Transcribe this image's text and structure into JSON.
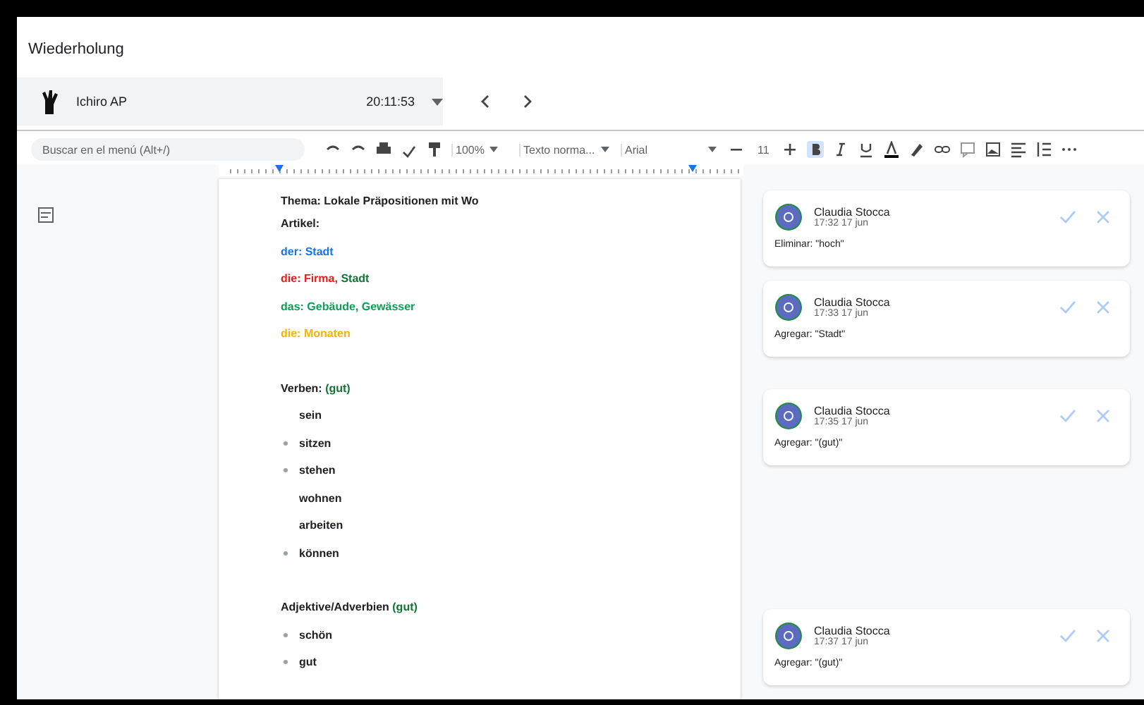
{
  "window": {
    "title": "Wiederholung"
  },
  "account": {
    "name": "Ichiro AP",
    "time": "20:11:53"
  },
  "toolbar": {
    "search_placeholder": "Buscar en el menú (Alt+/)",
    "zoom": "100%",
    "style": "Texto norma...",
    "font": "Arial",
    "size": "11",
    "bold_on": true
  },
  "document": {
    "lines": [
      {
        "kind": "heading",
        "segments": [
          {
            "text": "Thema: Lokale Präpositionen mit Wo",
            "color": "#202124"
          }
        ]
      },
      {
        "kind": "text",
        "segments": [
          {
            "text": "Artikel:",
            "color": "#202124"
          }
        ]
      },
      {
        "kind": "text",
        "segments": [
          {
            "text": "der: Stadt",
            "color": "#1a73e8"
          }
        ]
      },
      {
        "kind": "text",
        "segments": [
          {
            "text": "die",
            "color": "#ea1c1c"
          },
          {
            "text": ": Firma, ",
            "color": "#ea1c1c"
          },
          {
            "text": "Stadt",
            "color": "#137333"
          }
        ]
      },
      {
        "kind": "text",
        "segments": [
          {
            "text": "das",
            "color": "#0f9d58"
          },
          {
            "text": ": Gebäude, Gewässer",
            "color": "#0f9d58"
          }
        ]
      },
      {
        "kind": "text",
        "segments": [
          {
            "text": "die: Monaten",
            "color": "#f4b400"
          }
        ]
      },
      {
        "kind": "gap"
      },
      {
        "kind": "text",
        "segments": [
          {
            "text": "Verben: ",
            "color": "#202124"
          },
          {
            "text": "(gut)",
            "color": "#137333"
          }
        ]
      },
      {
        "kind": "item",
        "bullet": false,
        "segments": [
          {
            "text": "sein",
            "color": "#202124"
          }
        ]
      },
      {
        "kind": "item",
        "bullet": true,
        "segments": [
          {
            "text": "sitzen",
            "color": "#202124"
          }
        ]
      },
      {
        "kind": "item",
        "bullet": true,
        "segments": [
          {
            "text": "stehen",
            "color": "#202124"
          }
        ]
      },
      {
        "kind": "item",
        "bullet": false,
        "segments": [
          {
            "text": "wohnen",
            "color": "#202124"
          }
        ]
      },
      {
        "kind": "item",
        "bullet": false,
        "segments": [
          {
            "text": "arbeiten",
            "color": "#202124"
          }
        ]
      },
      {
        "kind": "item",
        "bullet": true,
        "segments": [
          {
            "text": "können",
            "color": "#202124"
          }
        ]
      },
      {
        "kind": "gap"
      },
      {
        "kind": "text",
        "segments": [
          {
            "text": "Adjektive/Adverbien ",
            "color": "#202124"
          },
          {
            "text": "(gut)",
            "color": "#137333"
          }
        ]
      },
      {
        "kind": "item",
        "bullet": true,
        "segments": [
          {
            "text": "schön",
            "color": "#202124"
          }
        ]
      },
      {
        "kind": "item",
        "bullet": true,
        "segments": [
          {
            "text": "gut",
            "color": "#202124"
          }
        ]
      }
    ]
  },
  "comments": [
    {
      "author": "Claudia Stocca",
      "time": "17:32 17 jun",
      "body": "Eliminar: \"hoch\""
    },
    {
      "author": "Claudia Stocca",
      "time": "17:33 17 jun",
      "body": "Agregar: \"Stadt\""
    },
    {
      "author": "Claudia Stocca",
      "time": "17:35 17 jun",
      "body": "Agregar: \"(gut)\""
    },
    {
      "author": "Claudia Stocca",
      "time": "17:37 17 jun",
      "body": "Agregar: \"(gut)\""
    }
  ]
}
